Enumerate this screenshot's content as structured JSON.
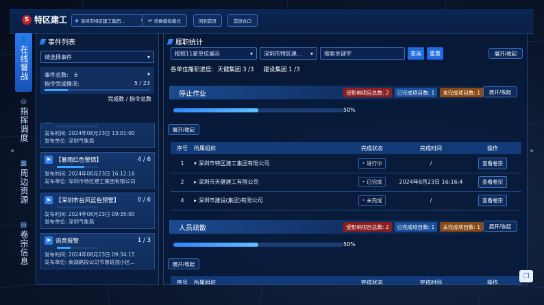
{
  "header": {
    "logo_text": "特区建工",
    "org_select": "深圳市特区建工集团...",
    "buttons": [
      "切换模拟模式",
      "回到首页",
      "首屏合口"
    ]
  },
  "leftnav": [
    {
      "label": "在线督战",
      "icon": "person-icon",
      "active": true
    },
    {
      "label": "指挥调度",
      "icon": "radar-icon",
      "active": false
    },
    {
      "label": "周边资源",
      "icon": "resource-icon",
      "active": false
    },
    {
      "label": "卷宗信息",
      "icon": "book-icon",
      "active": false
    }
  ],
  "event_panel": {
    "title": "事件列表",
    "select_placeholder": "请选择事件",
    "total_label": "事件总数:",
    "total_value": "6",
    "completion_label": "指令完成情况:",
    "completion_value": "5 / 23",
    "completion_fraction": 0.22,
    "legend": "完成数 / 指令总数",
    "events": [
      {
        "title": "【...】",
        "count": "",
        "time": "发布时间: 2024年08月23日 13:01:00",
        "unit": "发布单位: 深圳气象局",
        "progress": 0.0,
        "partial": true
      },
      {
        "title": "【暴雨红色警情】",
        "count": "4 / 6",
        "time": "发布时间: 2024年08月23日 16:12:16",
        "unit": "发布单位: 深圳市特区建工集团有限公司",
        "progress": 0.67,
        "partial": false
      },
      {
        "title": "【深圳市台风蓝色预警】",
        "count": "0 / 6",
        "time": "发布时间: 2024年08月23日 09:35:00",
        "unit": "发布单位: 深圳气象局",
        "progress": 0.0,
        "partial": false
      },
      {
        "title": "语音报警",
        "count": "1 / 3",
        "time": "发布时间: 2024年08月23日 09:34:15",
        "unit": "发布单位: 南湖路段公司节督班视小区...",
        "progress": 0.33,
        "partial": false
      }
    ]
  },
  "main": {
    "title": "履职统计",
    "filter_sort": "按照11家单位展示",
    "filter_org": "深圳市特区建...",
    "search_placeholder": "搜索关键字",
    "search_button": "查询",
    "reset_button": "重置",
    "expand_all": "展开/收起",
    "progress_label": "各单位履职进度:",
    "progress_items": [
      "天健集团 3 /3",
      "建设集团 1 /3"
    ],
    "sections": [
      {
        "title": "停止作业",
        "tags": [
          {
            "text": "受影响项目总数: 2",
            "color": "#8c1f1f"
          },
          {
            "text": "已完成项目数: 1",
            "color": "#1a4f9a"
          },
          {
            "text": "未完成项目数: 1",
            "color": "#8a4a14"
          }
        ],
        "toggle": "展开/收起",
        "percent": "50%",
        "progress": 0.5,
        "sub_toggle": "展开/收起",
        "columns": [
          "序号",
          "所属组织",
          "完成状态",
          "完成时间",
          "操作"
        ],
        "rows": [
          {
            "no": "1",
            "org": "▾ 深圳市特区建工集团有限公司",
            "status": "进行中",
            "status_color": "#35d3ff",
            "time": "/",
            "action": "查看卷宗"
          },
          {
            "no": "2",
            "org": "▸ 深圳市天健建工有限公司",
            "status": "已完成",
            "status_color": "#3ee07a",
            "time": "2024年8月23日 16:16:4",
            "action": "查看卷宗"
          },
          {
            "no": "4",
            "org": "▸ 深圳市建设(集团)有限公司",
            "status": "未完成",
            "status_color": "#ff5a5a",
            "time": "/",
            "action": "查看卷宗"
          }
        ]
      },
      {
        "title": "人员疏散",
        "tags": [
          {
            "text": "受影响项目总数: 2",
            "color": "#8c1f1f"
          },
          {
            "text": "已完成项目数: 1",
            "color": "#1a4f9a"
          },
          {
            "text": "未完成项目数: 1",
            "color": "#8a4a14"
          }
        ],
        "toggle": "展开/收起",
        "percent": "50%",
        "progress": 0.5,
        "sub_toggle": "展开/收起",
        "columns": [
          "序号",
          "所属组织",
          "完成状态",
          "完成时间",
          "操作"
        ]
      }
    ]
  }
}
